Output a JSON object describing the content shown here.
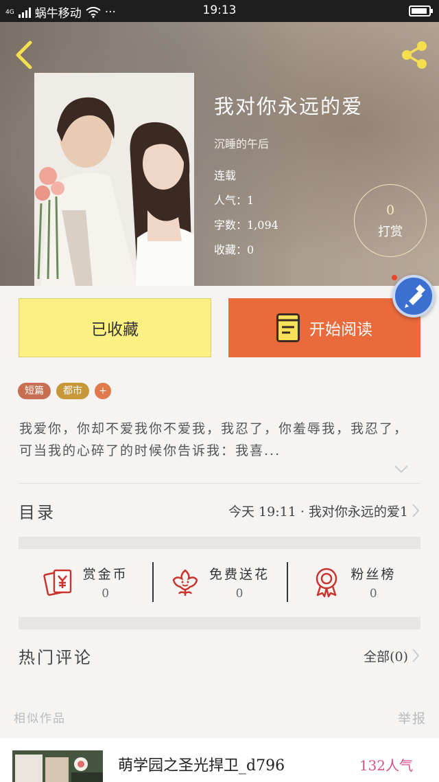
{
  "status_bar": {
    "network": "4G",
    "carrier": "蜗牛移动",
    "more": "···",
    "time": "19:13"
  },
  "book": {
    "title": "我对你永远的爱",
    "author": "沉睡的午后",
    "status": "连载",
    "popularity": "人气：1",
    "word_count": "字数：1,094",
    "favorites": "收藏：0"
  },
  "reward": {
    "count": "0",
    "label": "打赏"
  },
  "actions": {
    "favorited_label": "已收藏",
    "start_reading_label": "开始阅读"
  },
  "tags": [
    "短篇",
    "都市",
    "+"
  ],
  "description": "我爱你，你却不爱我你不爱我，我忍了，你羞辱我，我忍了，可当我的心碎了的时候你告诉我：我喜...",
  "catalog": {
    "label": "目录",
    "latest": "今天 19:11 · 我对你永远的爱1"
  },
  "stats": [
    {
      "icon": "red-envelope-icon",
      "label": "赏金币",
      "value": "0"
    },
    {
      "icon": "flower-icon",
      "label": "免费送花",
      "value": "0"
    },
    {
      "icon": "medal-icon",
      "label": "粉丝榜",
      "value": "0"
    }
  ],
  "comments": {
    "label": "热门评论",
    "all": "全部(0)"
  },
  "similar": {
    "label": "相似作品",
    "report": "举报",
    "items": [
      {
        "title": "萌学园之圣光捍卫_d796",
        "popularity": "132人气"
      }
    ]
  },
  "colors": {
    "favorite_button": "#fbf081",
    "read_button": "#e96a3b",
    "tag_short": "#c86e51",
    "tag_city": "#c79738",
    "icon_red": "#c9332c",
    "popularity_pink": "#d7508a"
  }
}
